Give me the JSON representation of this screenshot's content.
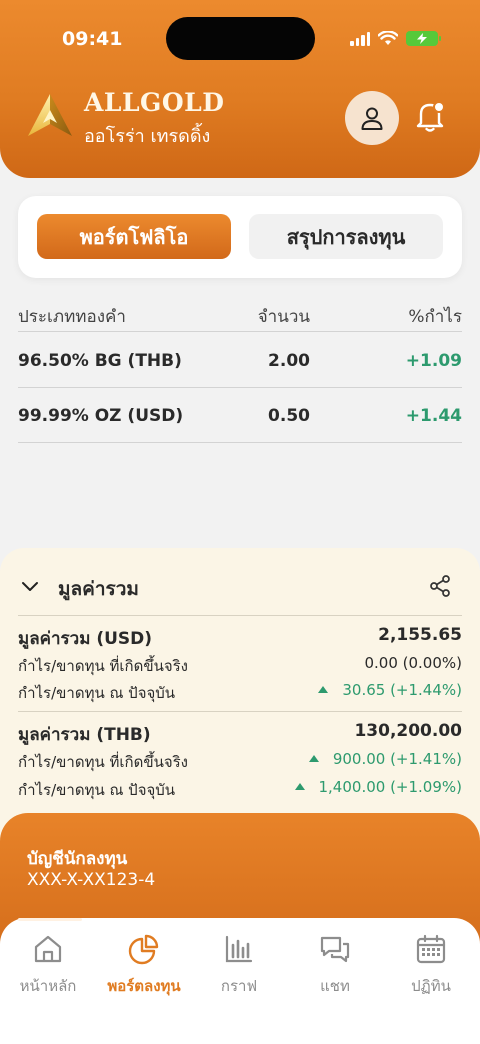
{
  "status_bar": {
    "time": "09:41"
  },
  "brand": {
    "name": "ALLGOLD",
    "subtitle": "ออโรร่า เทรดดิ้ง"
  },
  "tabs": [
    {
      "label": "พอร์ตโฟลิโอ",
      "active": true
    },
    {
      "label": "สรุปการลงทุน",
      "active": false
    }
  ],
  "portfolio_table": {
    "headers": [
      "ประเภททองคำ",
      "จำนวน",
      "%กำไร"
    ],
    "rows": [
      {
        "type": "96.50% BG (THB)",
        "amount": "2.00",
        "profit_pct": "+1.09"
      },
      {
        "type": "99.99% OZ (USD)",
        "amount": "0.50",
        "profit_pct": "+1.44"
      }
    ]
  },
  "summary": {
    "title": "มูลค่ารวม",
    "usd": {
      "label": "มูลค่ารวม (USD)",
      "value": "2,155.65",
      "realized_label": "กำไร/ขาดทุน ที่เกิดขึ้นจริง",
      "realized_value": "0.00 (0.00%)",
      "current_label": "กำไร/ขาดทุน ณ ปัจจุบัน",
      "current_value": "30.65 (+1.44%)"
    },
    "thb": {
      "label": "มูลค่ารวม (THB)",
      "value": "130,200.00",
      "realized_label": "กำไร/ขาดทุน ที่เกิดขึ้นจริง",
      "realized_value": "900.00 (+1.41%)",
      "current_label": "กำไร/ขาดทุน ณ ปัจจุบัน",
      "current_value": "1,400.00 (+1.09%)"
    }
  },
  "account": {
    "label": "บัญชีนักลงทุน",
    "number": "XXX-X-XX123-4"
  },
  "bottom_nav": [
    {
      "label": "หน้าหลัก",
      "icon": "home-icon",
      "active": false
    },
    {
      "label": "พอร์ตลงทุน",
      "icon": "pie-chart-icon",
      "active": true
    },
    {
      "label": "กราฟ",
      "icon": "bar-chart-icon",
      "active": false
    },
    {
      "label": "แชท",
      "icon": "chat-icon",
      "active": false
    },
    {
      "label": "ปฏิทิน",
      "icon": "calendar-icon",
      "active": false
    }
  ],
  "colors": {
    "accent": "#E07C22",
    "profit": "#2D9A6E",
    "summary_bg": "#FBF5E6"
  }
}
